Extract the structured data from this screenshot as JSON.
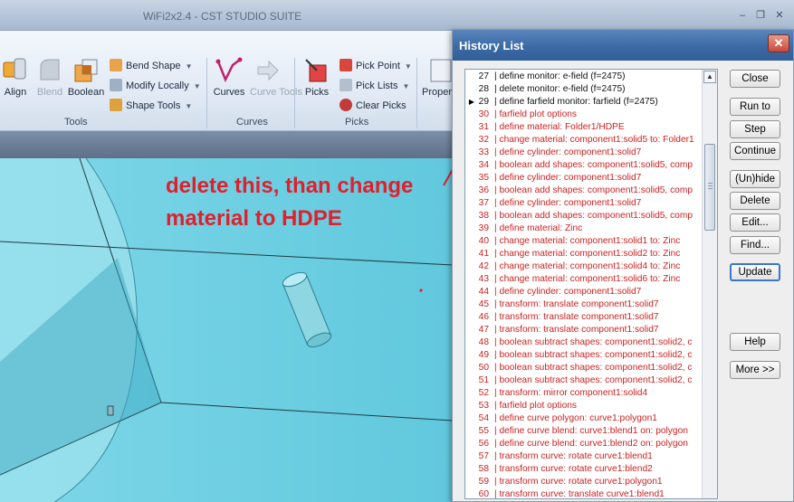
{
  "window": {
    "title": "WiFi2x2.4 - CST STUDIO SUITE",
    "controls": {
      "minimize": "–",
      "restore": "❐",
      "close": "✕"
    }
  },
  "ribbon": {
    "large_buttons": [
      {
        "label": "Align",
        "disabled": false
      },
      {
        "label": "Blend",
        "disabled": true
      },
      {
        "label": "Boolean",
        "disabled": false
      },
      {
        "label": "Curves",
        "disabled": false
      },
      {
        "label": "Curve Tools",
        "disabled": true
      },
      {
        "label": "Picks",
        "disabled": false
      },
      {
        "label": "Proper",
        "disabled": false
      }
    ],
    "small_buttons": {
      "bend_shape": "Bend Shape",
      "modify_locally": "Modify Locally",
      "shape_tools": "Shape Tools",
      "pick_point": "Pick Point",
      "pick_lists": "Pick Lists",
      "clear_picks": "Clear Picks"
    },
    "groups": {
      "tools": "Tools",
      "curves": "Curves",
      "picks": "Picks"
    },
    "dropdown_glyph": "▼"
  },
  "annotation": {
    "line1": "delete this, than change",
    "line2": "material to HDPE",
    "color": "#e0202d"
  },
  "history_dialog": {
    "title": "History List",
    "close_glyph": "✕",
    "current_marker": "▶",
    "scroll_up_glyph": "▲",
    "items": [
      {
        "num": "27",
        "text": "| define monitor: e-field (f=2475)",
        "state": "done"
      },
      {
        "num": "28",
        "text": "| delete monitor: e-field (f=2475)",
        "state": "done"
      },
      {
        "num": "29",
        "text": "| define farfield monitor: farfield (f=2475)",
        "state": "done",
        "current": true
      },
      {
        "num": "30",
        "text": "| farfield plot options",
        "state": "pending"
      },
      {
        "num": "31",
        "text": "| define material: Folder1/HDPE",
        "state": "pending"
      },
      {
        "num": "32",
        "text": "| change material: component1:solid5 to: Folder1",
        "state": "pending"
      },
      {
        "num": "33",
        "text": "| define cylinder: component1:solid7",
        "state": "pending"
      },
      {
        "num": "34",
        "text": "| boolean add shapes: component1:solid5, comp",
        "state": "pending"
      },
      {
        "num": "35",
        "text": "| define cylinder: component1:solid7",
        "state": "pending"
      },
      {
        "num": "36",
        "text": "| boolean add shapes: component1:solid5, comp",
        "state": "pending"
      },
      {
        "num": "37",
        "text": "| define cylinder: component1:solid7",
        "state": "pending"
      },
      {
        "num": "38",
        "text": "| boolean add shapes: component1:solid5, comp",
        "state": "pending"
      },
      {
        "num": "39",
        "text": "| define material: Zinc",
        "state": "pending"
      },
      {
        "num": "40",
        "text": "| change material: component1:solid1 to: Zinc",
        "state": "pending"
      },
      {
        "num": "41",
        "text": "| change material: component1:solid2 to: Zinc",
        "state": "pending"
      },
      {
        "num": "42",
        "text": "| change material: component1:solid4 to: Zinc",
        "state": "pending"
      },
      {
        "num": "43",
        "text": "| change material: component1:solid6 to: Zinc",
        "state": "pending"
      },
      {
        "num": "44",
        "text": "| define cylinder: component1:solid7",
        "state": "pending"
      },
      {
        "num": "45",
        "text": "| transform: translate component1:solid7",
        "state": "pending"
      },
      {
        "num": "46",
        "text": "| transform: translate component1:solid7",
        "state": "pending"
      },
      {
        "num": "47",
        "text": "| transform: translate component1:solid7",
        "state": "pending"
      },
      {
        "num": "48",
        "text": "| boolean subtract shapes: component1:solid2, c",
        "state": "pending"
      },
      {
        "num": "49",
        "text": "| boolean subtract shapes: component1:solid2, c",
        "state": "pending"
      },
      {
        "num": "50",
        "text": "| boolean subtract shapes: component1:solid2, c",
        "state": "pending"
      },
      {
        "num": "51",
        "text": "| boolean subtract shapes: component1:solid2, c",
        "state": "pending"
      },
      {
        "num": "52",
        "text": "| transform: mirror component1:solid4",
        "state": "pending"
      },
      {
        "num": "53",
        "text": "| farfield plot options",
        "state": "pending"
      },
      {
        "num": "54",
        "text": "| define curve polygon: curve1:polygon1",
        "state": "pending"
      },
      {
        "num": "55",
        "text": "| define curve blend: curve1:blend1 on: polygon",
        "state": "pending"
      },
      {
        "num": "56",
        "text": "| define curve blend: curve1:blend2 on: polygon",
        "state": "pending"
      },
      {
        "num": "57",
        "text": "| transform curve: rotate curve1:blend1",
        "state": "pending"
      },
      {
        "num": "58",
        "text": "| transform curve: rotate curve1:blend2",
        "state": "pending"
      },
      {
        "num": "59",
        "text": "| transform curve: rotate curve1:polygon1",
        "state": "pending"
      },
      {
        "num": "60",
        "text": "| transform curve: translate curve1:blend1",
        "state": "pending"
      }
    ],
    "buttons": {
      "close": "Close",
      "run_to": "Run to",
      "step": "Step",
      "continue": "Continue",
      "unhide": "(Un)hide",
      "delete": "Delete",
      "edit": "Edit...",
      "find": "Find...",
      "update": "Update",
      "help": "Help",
      "more": "More >>"
    }
  }
}
